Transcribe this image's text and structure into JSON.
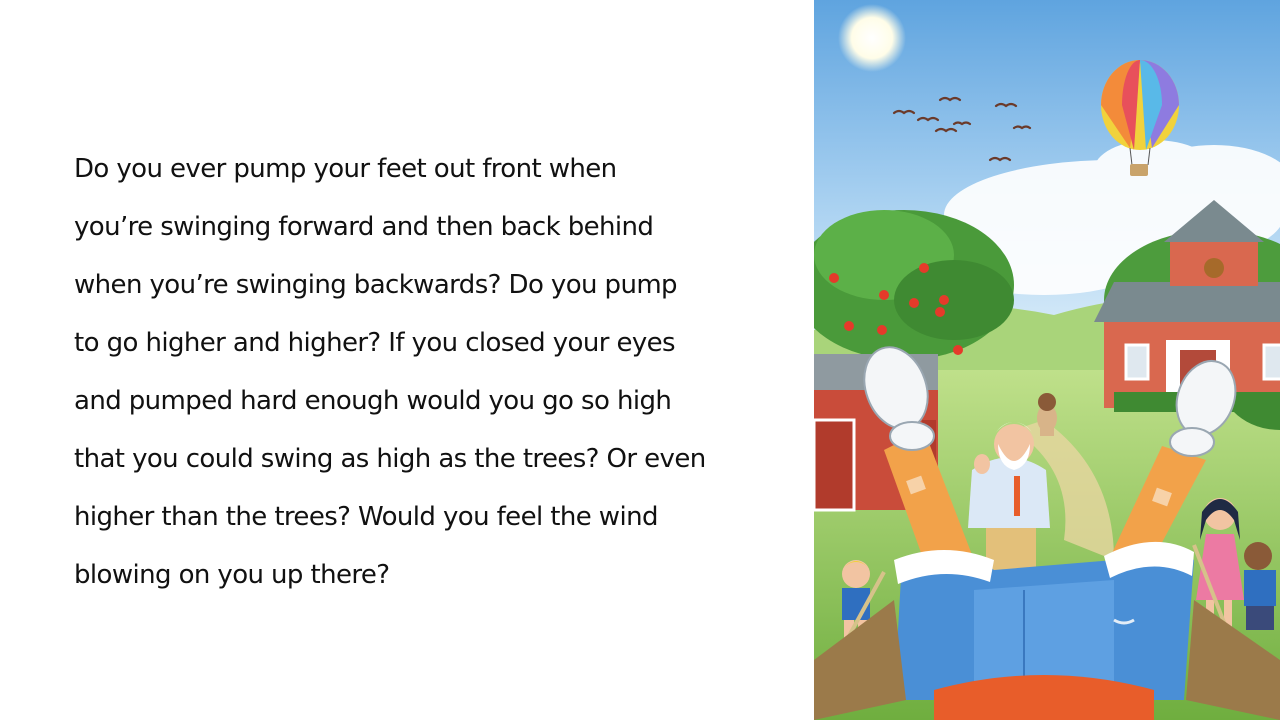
{
  "slide": {
    "story_lines": [
      "Do you ever pump your feet out front when",
      "you’re swinging forward and then back behind",
      "when you’re swinging backwards? Do you pump",
      "to go higher and higher? If you closed your eyes",
      "and pumped hard enough would you go so high",
      "that you could swing as high as the trees? Or even",
      "higher than the trees? Would you feel the wind",
      "blowing on you up there?"
    ]
  },
  "colors": {
    "sky_top": "#5fa4df",
    "sky_bottom": "#cfe6f7",
    "grass": "#8cc454",
    "brick": "#d9684f",
    "jeans": "#4a8fd6"
  }
}
